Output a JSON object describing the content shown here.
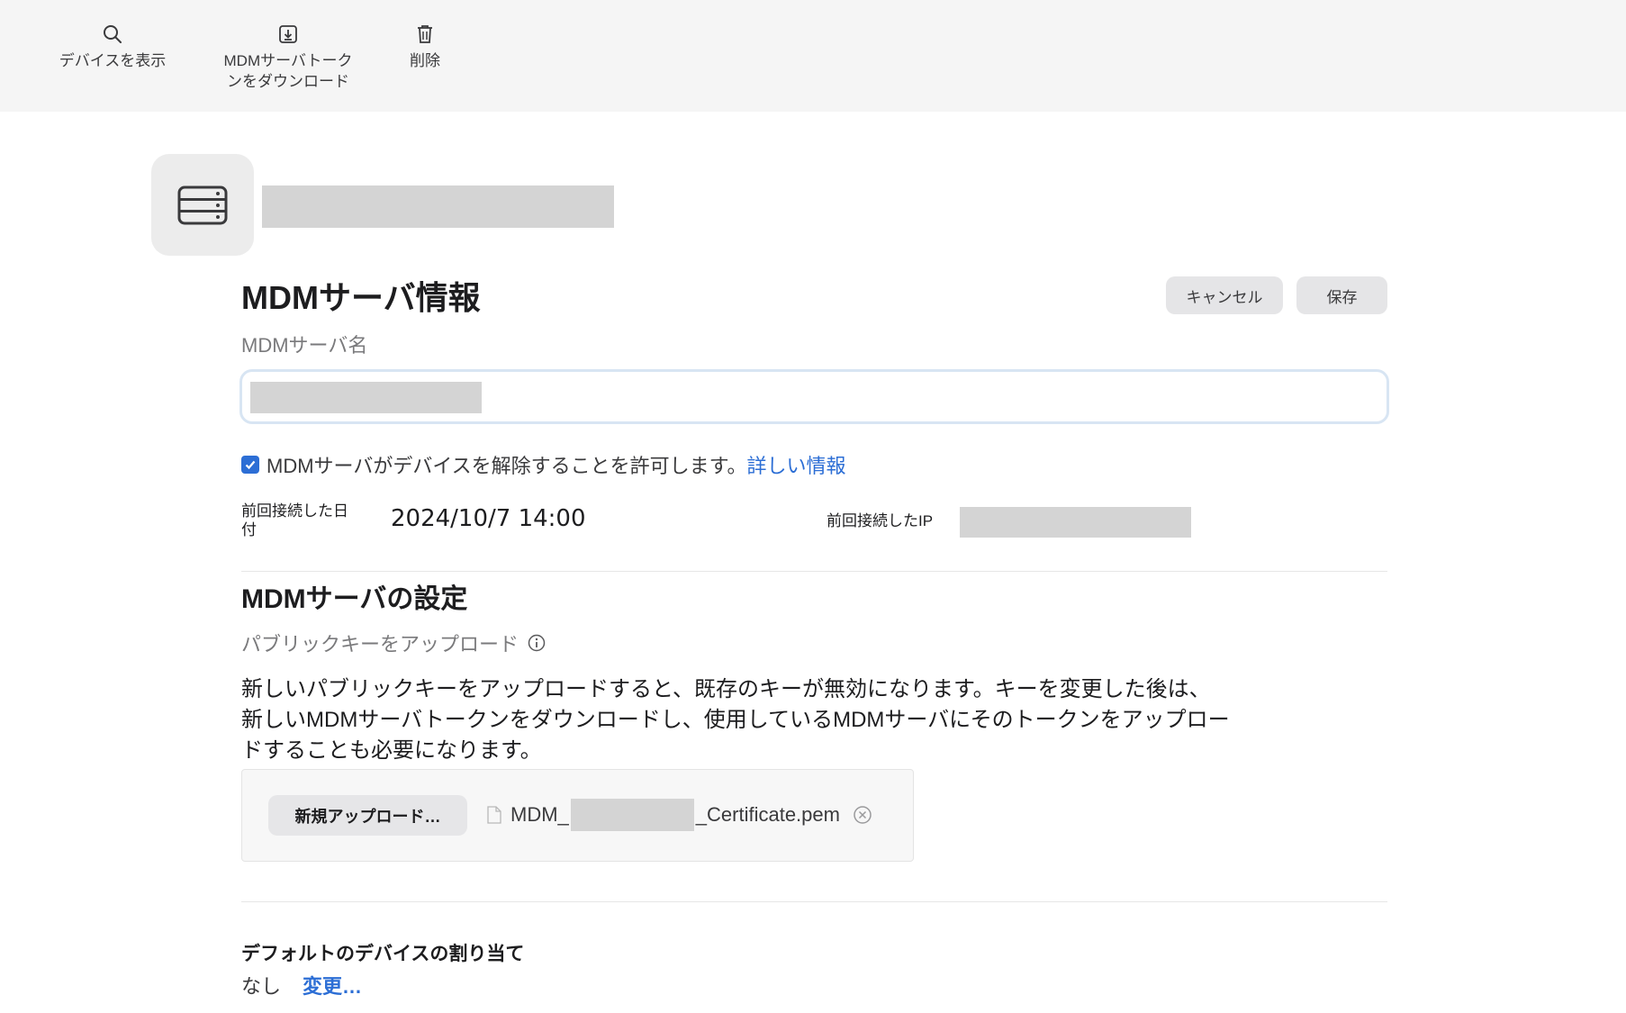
{
  "toolbar": {
    "show_devices": "デバイスを表示",
    "download_token_line1": "MDMサーバトーク",
    "download_token_line2": "ンをダウンロード",
    "delete": "削除"
  },
  "header": {
    "server_icon": "server-icon"
  },
  "server_info": {
    "title": "MDMサーバ情報",
    "cancel_label": "キャンセル",
    "save_label": "保存",
    "name_label": "MDMサーバ名",
    "allow_release_checked": true,
    "allow_release_text": "MDMサーバがデバイスを解除することを許可します。",
    "learn_more": "詳しい情報",
    "last_connected_date_label": "前回接続した日付",
    "last_connected_date": "2024/10/7 14:00",
    "last_connected_ip_label": "前回接続したIP"
  },
  "settings": {
    "title": "MDMサーバの設定",
    "upload_public_key_label": "パブリックキーをアップロード",
    "description": "新しいパブリックキーをアップロードすると、既存のキーが無効になります。キーを変更した後は、新しいMDMサーバトークンをダウンロードし、使用しているMDMサーバにそのトークンをアップロードすることも必要になります。",
    "new_upload_label": "新規アップロード…",
    "file_prefix": "MDM_",
    "file_suffix": "_Certificate.pem"
  },
  "default_assignment": {
    "title": "デフォルトのデバイスの割り当て",
    "value": "なし",
    "change_label": "変更…"
  }
}
